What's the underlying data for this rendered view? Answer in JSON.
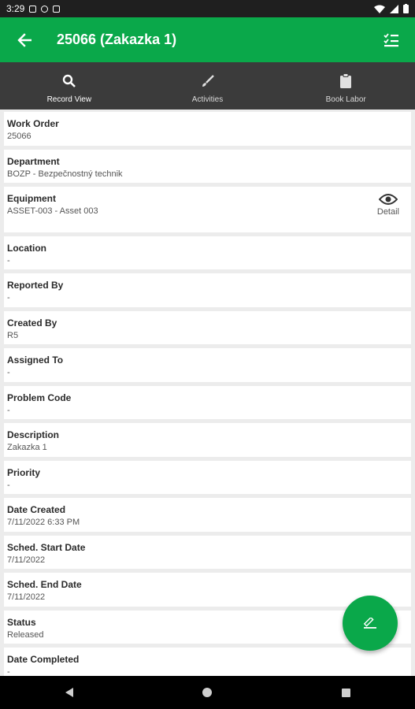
{
  "status_bar": {
    "time": "3:29"
  },
  "header": {
    "title": "25066 (Zakazka 1)"
  },
  "tabs": [
    {
      "label": "Record View",
      "icon": "search-icon"
    },
    {
      "label": "Activities",
      "icon": "brush-icon"
    },
    {
      "label": "Book Labor",
      "icon": "clipboard-icon"
    }
  ],
  "fields": [
    {
      "label": "Work Order",
      "value": "25066"
    },
    {
      "label": "Department",
      "value": "BOZP - Bezpečnostný technik"
    },
    {
      "label": "Equipment",
      "value": "ASSET-003 - Asset 003",
      "action_label": "Detail"
    },
    {
      "label": "Location",
      "value": "-"
    },
    {
      "label": "Reported By",
      "value": "-"
    },
    {
      "label": "Created By",
      "value": "R5"
    },
    {
      "label": "Assigned To",
      "value": "-"
    },
    {
      "label": "Problem Code",
      "value": "-"
    },
    {
      "label": "Description",
      "value": "Zakazka 1"
    },
    {
      "label": "Priority",
      "value": "-"
    },
    {
      "label": "Date Created",
      "value": "7/11/2022 6:33 PM"
    },
    {
      "label": "Sched. Start Date",
      "value": "7/11/2022"
    },
    {
      "label": "Sched. End Date",
      "value": "7/11/2022"
    },
    {
      "label": "Status",
      "value": "Released"
    },
    {
      "label": "Date Completed",
      "value": "-"
    }
  ],
  "colors": {
    "brand": "#0aa84a",
    "tab_bar": "#3b3b3b"
  }
}
